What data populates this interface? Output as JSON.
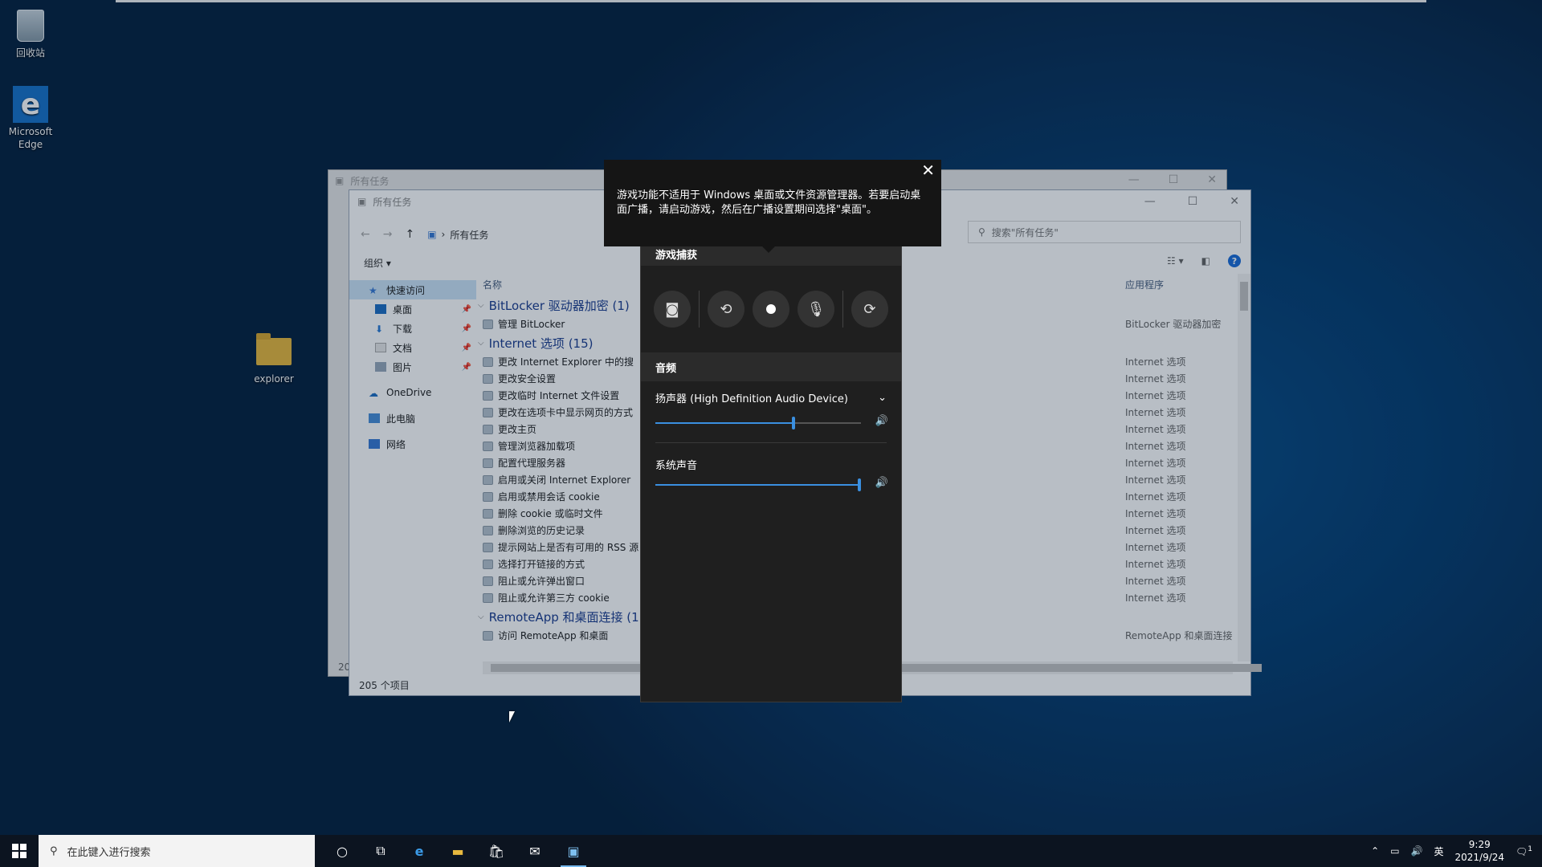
{
  "desktop": {
    "icons": [
      {
        "label": "回收站",
        "icon": "recycle-bin-icon"
      },
      {
        "label": "Microsoft Edge",
        "icon": "edge-icon"
      },
      {
        "label": "explorer",
        "icon": "folder-icon"
      }
    ]
  },
  "back_window": {
    "title": "所有任务"
  },
  "explorer": {
    "title": "所有任务",
    "path": "所有任务",
    "search_placeholder": "搜索\"所有任务\"",
    "organize": "组织 ▾",
    "nav": {
      "quick_access": "快速访问",
      "desktop": "桌面",
      "downloads": "下载",
      "documents": "文档",
      "pictures": "图片",
      "onedrive": "OneDrive",
      "this_pc": "此电脑",
      "network": "网络"
    },
    "columns": {
      "name": "名称",
      "app": "应用程序"
    },
    "groups": [
      {
        "header": "BitLocker 驱动器加密 (1)",
        "rows": [
          {
            "name": "管理 BitLocker",
            "app": "BitLocker 驱动器加密"
          }
        ]
      },
      {
        "header": "Internet 选项 (15)",
        "rows": [
          {
            "name": "更改 Internet Explorer 中的搜",
            "app": "Internet 选项"
          },
          {
            "name": "更改安全设置",
            "app": "Internet 选项"
          },
          {
            "name": "更改临时 Internet 文件设置",
            "app": "Internet 选项"
          },
          {
            "name": "更改在选项卡中显示网页的方式",
            "app": "Internet 选项"
          },
          {
            "name": "更改主页",
            "app": "Internet 选项"
          },
          {
            "name": "管理浏览器加载项",
            "app": "Internet 选项"
          },
          {
            "name": "配置代理服务器",
            "app": "Internet 选项"
          },
          {
            "name": "启用或关闭 Internet Explorer",
            "app": "Internet 选项"
          },
          {
            "name": "启用或禁用会话 cookie",
            "app": "Internet 选项"
          },
          {
            "name": "删除 cookie 或临时文件",
            "app": "Internet 选项"
          },
          {
            "name": "删除浏览的历史记录",
            "app": "Internet 选项"
          },
          {
            "name": "提示网站上是否有可用的 RSS 源",
            "app": "Internet 选项"
          },
          {
            "name": "选择打开链接的方式",
            "app": "Internet 选项"
          },
          {
            "name": "阻止或允许弹出窗口",
            "app": "Internet 选项"
          },
          {
            "name": "阻止或允许第三方 cookie",
            "app": "Internet 选项"
          }
        ]
      },
      {
        "header": "RemoteApp 和桌面连接 (1)",
        "rows": [
          {
            "name": "访问 RemoteApp 和桌面",
            "app": "RemoteApp 和桌面连接"
          }
        ]
      }
    ],
    "status": "205 个项目",
    "back_number": "20"
  },
  "tooltip": {
    "text": "游戏功能不适用于 Windows 桌面或文件资源管理器。若要启动桌面广播，请启动游戏，然后在广播设置期间选择\"桌面\"。"
  },
  "gamebar": {
    "capture_title": "游戏捕获",
    "capture_buttons": [
      "camera-icon",
      "replay-icon",
      "record-icon",
      "mic-off-icon",
      "broadcast-icon"
    ],
    "audio_title": "音频",
    "device": "扬声器 (High Definition Audio Device)",
    "device_volume": 0.67,
    "system_label": "系统声音",
    "system_volume": 1.0
  },
  "taskbar": {
    "search_placeholder": "在此键入进行搜索",
    "apps": [
      "cortana-icon",
      "task-view-icon",
      "edge-icon",
      "file-explorer-icon",
      "store-icon",
      "mail-icon",
      "control-panel-icon"
    ],
    "ime": "英",
    "time": "9:29",
    "date": "2021/9/24",
    "notification_count": "1"
  }
}
